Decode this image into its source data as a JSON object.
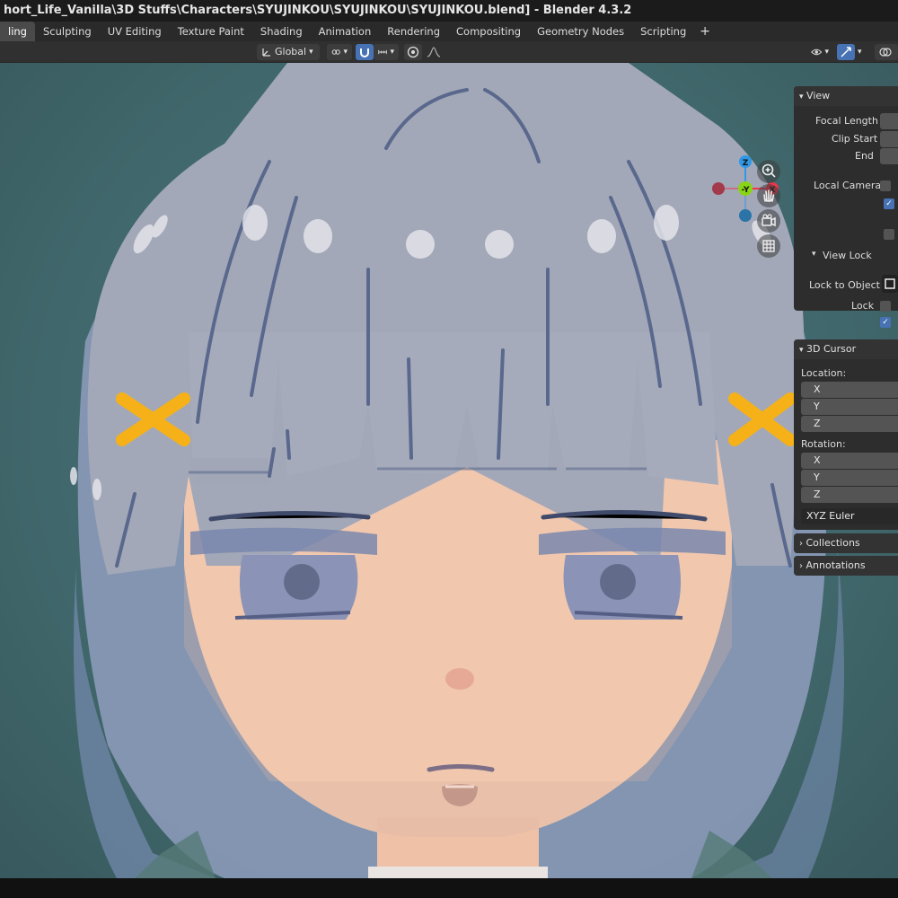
{
  "window": {
    "title": "hort_Life_Vanilla\\3D Stuffs\\Characters\\SYUJINKOU\\SYUJINKOU\\SYUJINKOU.blend] - Blender 4.3.2"
  },
  "workspaces": {
    "tabs": [
      "ling",
      "Sculpting",
      "UV Editing",
      "Texture Paint",
      "Shading",
      "Animation",
      "Rendering",
      "Compositing",
      "Geometry Nodes",
      "Scripting"
    ],
    "active_index": 0,
    "add_label": "+"
  },
  "header": {
    "orientation_label": "Global",
    "dropdown_glyph": "⌄"
  },
  "gizmo": {
    "z_label": "Z",
    "y_label": "-Y",
    "x_label": "X",
    "colors": {
      "x": "#f0364d",
      "y": "#89d414",
      "z": "#2f98e6"
    }
  },
  "npanel": {
    "view": {
      "header": "View",
      "focal_length": "Focal Length",
      "clip_start": "Clip Start",
      "end": "End",
      "local_camera": "Local Camera",
      "view_lock_header": "View Lock",
      "lock_to_object": "Lock to Object",
      "lock": "Lock"
    },
    "cursor": {
      "header": "3D Cursor",
      "location_label": "Location:",
      "rotation_label": "Rotation:",
      "axes": [
        "X",
        "Y",
        "Z"
      ],
      "rotation_mode": "XYZ Euler"
    },
    "collections_header": "Collections",
    "annotations_header": "Annotations"
  },
  "colors": {
    "accent": "#4772b3",
    "viewport_bg": "#426b6e",
    "hair": "#a3a8b8",
    "skin": "#f1c7ae",
    "hairclip": "#f5b117"
  }
}
